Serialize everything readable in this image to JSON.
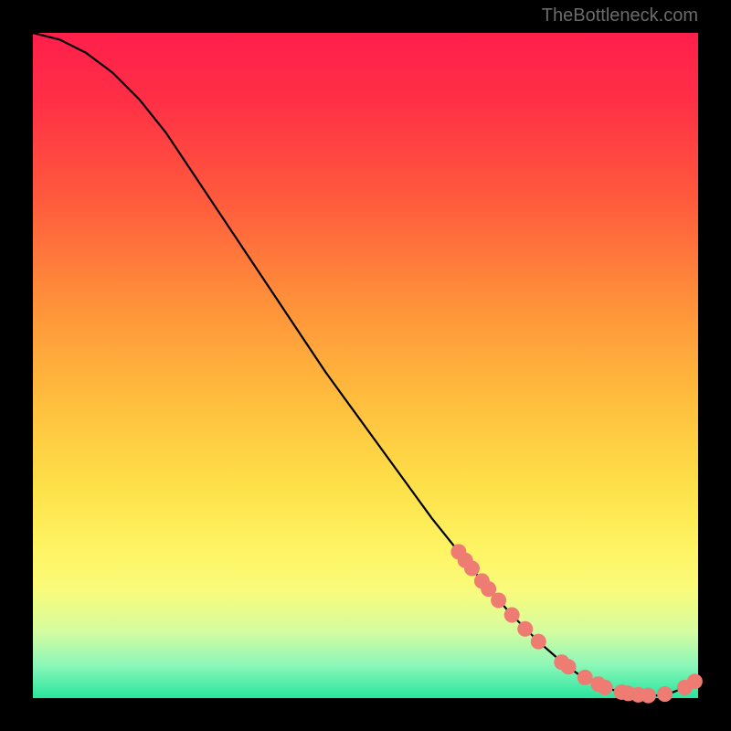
{
  "watermark": "TheBottleneck.com",
  "chart_data": {
    "type": "line",
    "title": "",
    "xlabel": "",
    "ylabel": "",
    "xlim": [
      0,
      100
    ],
    "ylim": [
      0,
      100
    ],
    "x": [
      0,
      4,
      8,
      12,
      16,
      20,
      24,
      28,
      32,
      36,
      40,
      44,
      48,
      52,
      56,
      60,
      64,
      68,
      72,
      76,
      80,
      82,
      84,
      86,
      88,
      90,
      92,
      94,
      96,
      98,
      100
    ],
    "values": [
      100,
      99,
      97,
      94,
      90,
      85,
      79,
      73,
      67,
      61,
      55,
      49,
      43.5,
      38,
      32.5,
      27,
      22,
      17,
      12.5,
      8.5,
      5.0,
      3.6,
      2.5,
      1.6,
      1.0,
      0.6,
      0.4,
      0.4,
      0.8,
      1.6,
      3.0
    ],
    "markers_x": [
      64,
      65,
      66,
      67.5,
      68.5,
      70,
      72,
      74,
      76,
      79.5,
      80.5,
      83,
      85,
      86,
      88.5,
      89.5,
      91,
      92.5,
      95,
      98,
      99.5
    ],
    "markers_y": [
      22,
      20.7,
      19.5,
      17.6,
      16.4,
      14.7,
      12.5,
      10.4,
      8.5,
      5.4,
      4.7,
      3.1,
      2.1,
      1.6,
      0.9,
      0.7,
      0.5,
      0.4,
      0.6,
      1.6,
      2.5
    ],
    "marker_color": "#ee7c72",
    "line_color": "#000000"
  }
}
